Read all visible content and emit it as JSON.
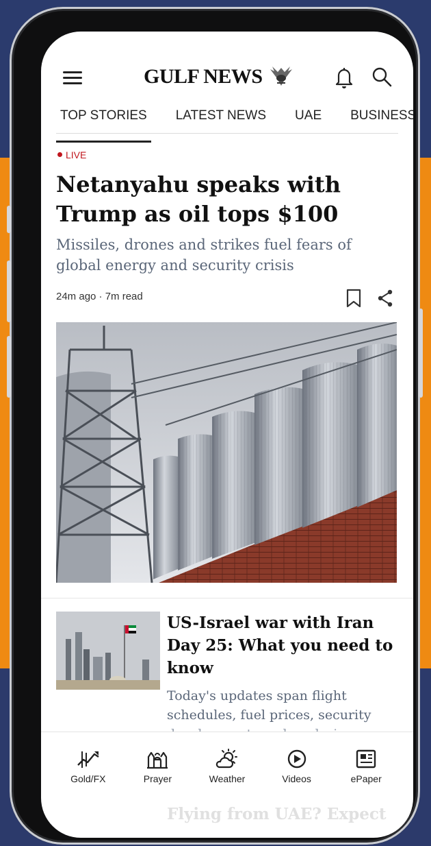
{
  "app": {
    "logo_text": "GULF NEWS",
    "brand_color": "#111111"
  },
  "tabs": [
    {
      "label": "TOP STORIES",
      "active": true
    },
    {
      "label": "LATEST NEWS",
      "active": false
    },
    {
      "label": "UAE",
      "active": false
    },
    {
      "label": "BUSINESS",
      "active": false
    }
  ],
  "lead": {
    "live_label": "LIVE",
    "headline": "Netanyahu speaks with Trump as oil tops $100",
    "subhead": "Missiles, drones and strikes fuel fears of global energy and security crisis",
    "meta": "24m ago · 7m read"
  },
  "story2": {
    "title": "US-Israel war with Iran Day 25: What you need to know",
    "summary": "Today's updates span flight schedules, fuel prices, security",
    "summary_cut": "developments and analysis"
  },
  "story3": {
    "title_ghost": "Flying from UAE? Expect"
  },
  "bottom_nav": [
    {
      "label": "Gold/FX",
      "icon": "gold-fx-icon"
    },
    {
      "label": "Prayer",
      "icon": "prayer-icon"
    },
    {
      "label": "Weather",
      "icon": "weather-icon"
    },
    {
      "label": "Videos",
      "icon": "play-icon"
    },
    {
      "label": "ePaper",
      "icon": "epaper-icon"
    }
  ],
  "colors": {
    "live": "#c0171e",
    "orange_band": "#ef8a12",
    "navy_bg": "#2c3a6b"
  }
}
